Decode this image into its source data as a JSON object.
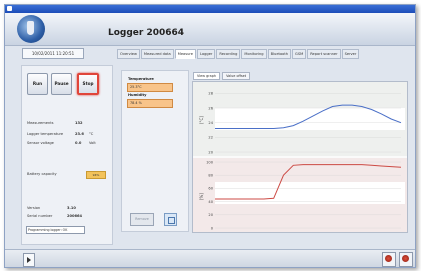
{
  "window": {
    "title": "Logger 200664"
  },
  "toolbar": {
    "date_value": "10/02/2011 11:20:51"
  },
  "tabs": [
    {
      "label": "Overview",
      "active": false
    },
    {
      "label": "Measured data",
      "active": false
    },
    {
      "label": "Measure",
      "active": true
    },
    {
      "label": "Logger",
      "active": false
    },
    {
      "label": "Recording",
      "active": false
    },
    {
      "label": "Monitoring",
      "active": false
    },
    {
      "label": "Bluetooth",
      "active": false
    },
    {
      "label": "GSM",
      "active": false
    },
    {
      "label": "Report scanner",
      "active": false
    },
    {
      "label": "Server",
      "active": false
    }
  ],
  "controls": {
    "run": "Run",
    "pause": "Pause",
    "stop": "Stop"
  },
  "status": {
    "measurements_label": "Measurements",
    "measurements_value": "132",
    "logger_temp_label": "Logger temperature",
    "logger_temp_value": "23.6",
    "logger_temp_unit": "°C",
    "sensor_voltage_label": "Sensor voltage",
    "sensor_voltage_value": "0.0",
    "sensor_voltage_unit": "Volt",
    "battery_label": "Battery capacity",
    "battery_value": "94%",
    "version_label": "Version",
    "version_value": "3.10",
    "serial_label": "Serial number",
    "serial_value": "200664",
    "programming_value": "Programming logger: OK"
  },
  "sensors": {
    "temperature_label": "Temperature",
    "temperature_value": "25.3°C",
    "humidity_label": "Humidity",
    "humidity_value": "78.4 %",
    "remove_button": "Remove"
  },
  "chart_tabs": [
    {
      "label": "View graph",
      "active": true
    },
    {
      "label": "Value offset",
      "active": false
    }
  ],
  "chart_data": [
    {
      "type": "line",
      "ylabel": "[°C]",
      "yticks": [
        20,
        22,
        24,
        26,
        28
      ],
      "ylim": [
        20,
        29
      ],
      "series": [
        {
          "color": "#4a6fc7",
          "y": [
            23.2,
            23.2,
            23.2,
            23.2,
            23.2,
            23.2,
            23.2,
            23.3,
            23.6,
            24.2,
            24.9,
            25.6,
            26.2,
            26.4,
            26.4,
            26.2,
            25.8,
            25.2,
            24.5,
            24.0
          ]
        }
      ]
    },
    {
      "type": "line",
      "ylabel": "[%]",
      "yticks": [
        0,
        20,
        40,
        60,
        80,
        100
      ],
      "ylim": [
        0,
        100
      ],
      "series": [
        {
          "color": "#cc4a44",
          "y": [
            44,
            44,
            44,
            44,
            44,
            44,
            45,
            80,
            95,
            96,
            96,
            96,
            96,
            96,
            96,
            96,
            95,
            94,
            93,
            92
          ]
        }
      ]
    }
  ]
}
